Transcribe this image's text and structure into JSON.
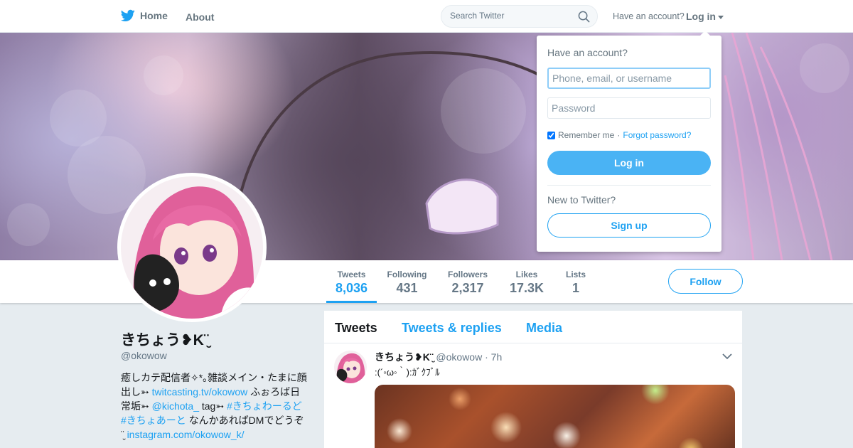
{
  "nav": {
    "home_label": "Home",
    "about_label": "About",
    "search_placeholder": "Search Twitter",
    "have_account_text": "Have an account?",
    "login_label": "Log in",
    "brand_color": "#1da1f2",
    "icons": [
      "twitter-bird-icon",
      "search-icon",
      "caret-down-icon"
    ]
  },
  "profile": {
    "name": "きちょう❥K¨̮",
    "handle": "@okowow",
    "bio": {
      "t1": "癒しカテ配信者✧*｡雑談メイン・たまに顔出し➳ ",
      "l1": "twitcasting.tv/okowow",
      "t2": " ふぉろば日常垢➳ ",
      "l2": "@kichota_",
      "t3": " tag➳ ",
      "l3": "#きちょわーるど",
      "t4": " ",
      "l4": "#きちょあーと",
      "t5": " なんかあればDMでどうぞ ¨̮ ",
      "l5": "instagram.com/okowow_k/"
    },
    "follow_label": "Follow"
  },
  "stats": [
    {
      "label": "Tweets",
      "value": "8,036",
      "active": true
    },
    {
      "label": "Following",
      "value": "431"
    },
    {
      "label": "Followers",
      "value": "2,317"
    },
    {
      "label": "Likes",
      "value": "17.3K"
    },
    {
      "label": "Lists",
      "value": "1"
    }
  ],
  "timeline": {
    "tabs": [
      "Tweets",
      "Tweets & replies",
      "Media"
    ],
    "active_tab": "Tweets",
    "tweet": {
      "name": "きちょう❥K¨̮",
      "handle": "@okowow",
      "separator": "·",
      "time": "7h",
      "text": ":(´◦ω◦｀):ｶﾞｸﾌﾞﾙ"
    }
  },
  "login_dropdown": {
    "title": "Have an account?",
    "username_placeholder": "Phone, email, or username",
    "password_placeholder": "Password",
    "remember_label": "Remember me",
    "separator": "·",
    "forgot_label": "Forgot password?",
    "login_button": "Log in",
    "new_text": "New to Twitter?",
    "signup_button": "Sign up"
  }
}
